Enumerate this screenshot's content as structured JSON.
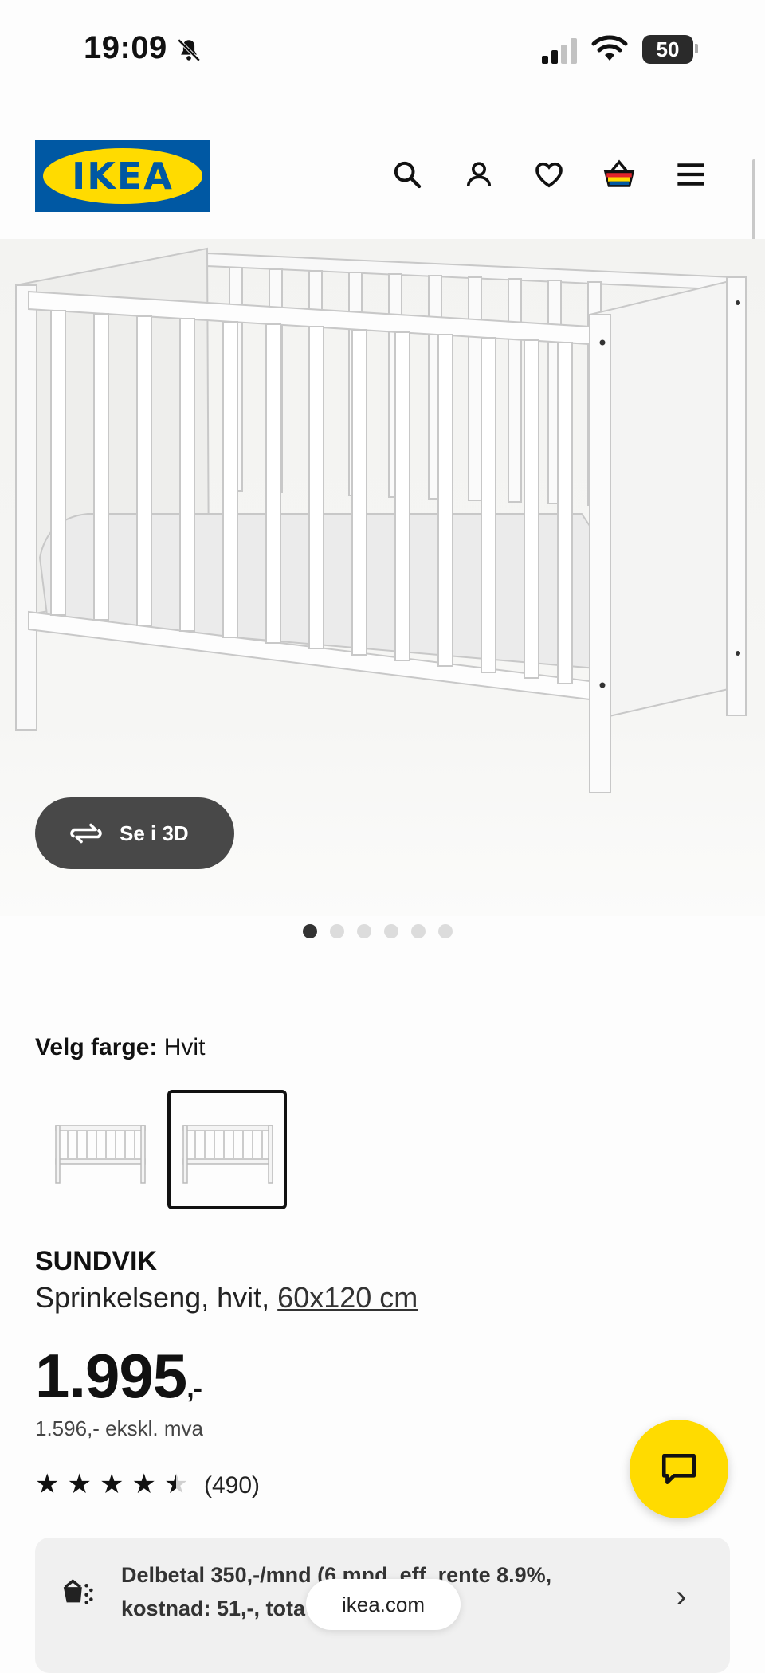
{
  "status_bar": {
    "time": "19:09",
    "battery": "50"
  },
  "header": {
    "logo_text": "IKEA",
    "icons": [
      "search-icon",
      "account-icon",
      "heart-icon",
      "basket-icon",
      "menu-icon"
    ]
  },
  "gallery": {
    "see_3d_label": "Se i 3D",
    "image_count": 6,
    "active_index": 0
  },
  "color": {
    "label": "Velg farge:",
    "value": "Hvit",
    "selected_index": 1
  },
  "product": {
    "name": "SUNDVIK",
    "description": "Sprinkelseng, hvit,",
    "size": "60x120 cm",
    "price": "1.995",
    "price_suffix": ",-",
    "price_ex_vat": "1.596,- ekskl. mva",
    "rating": 4.5,
    "rating_count": "(490)"
  },
  "financing": {
    "line1": "Delbetal 350,-/mnd (6 mnd, eff. rente 8.9%,",
    "line2": "kostnad: 51,-, tota"
  },
  "browser": {
    "url": "ikea.com"
  },
  "colors": {
    "brand_blue": "#0058a3",
    "brand_yellow": "#ffdb00"
  }
}
